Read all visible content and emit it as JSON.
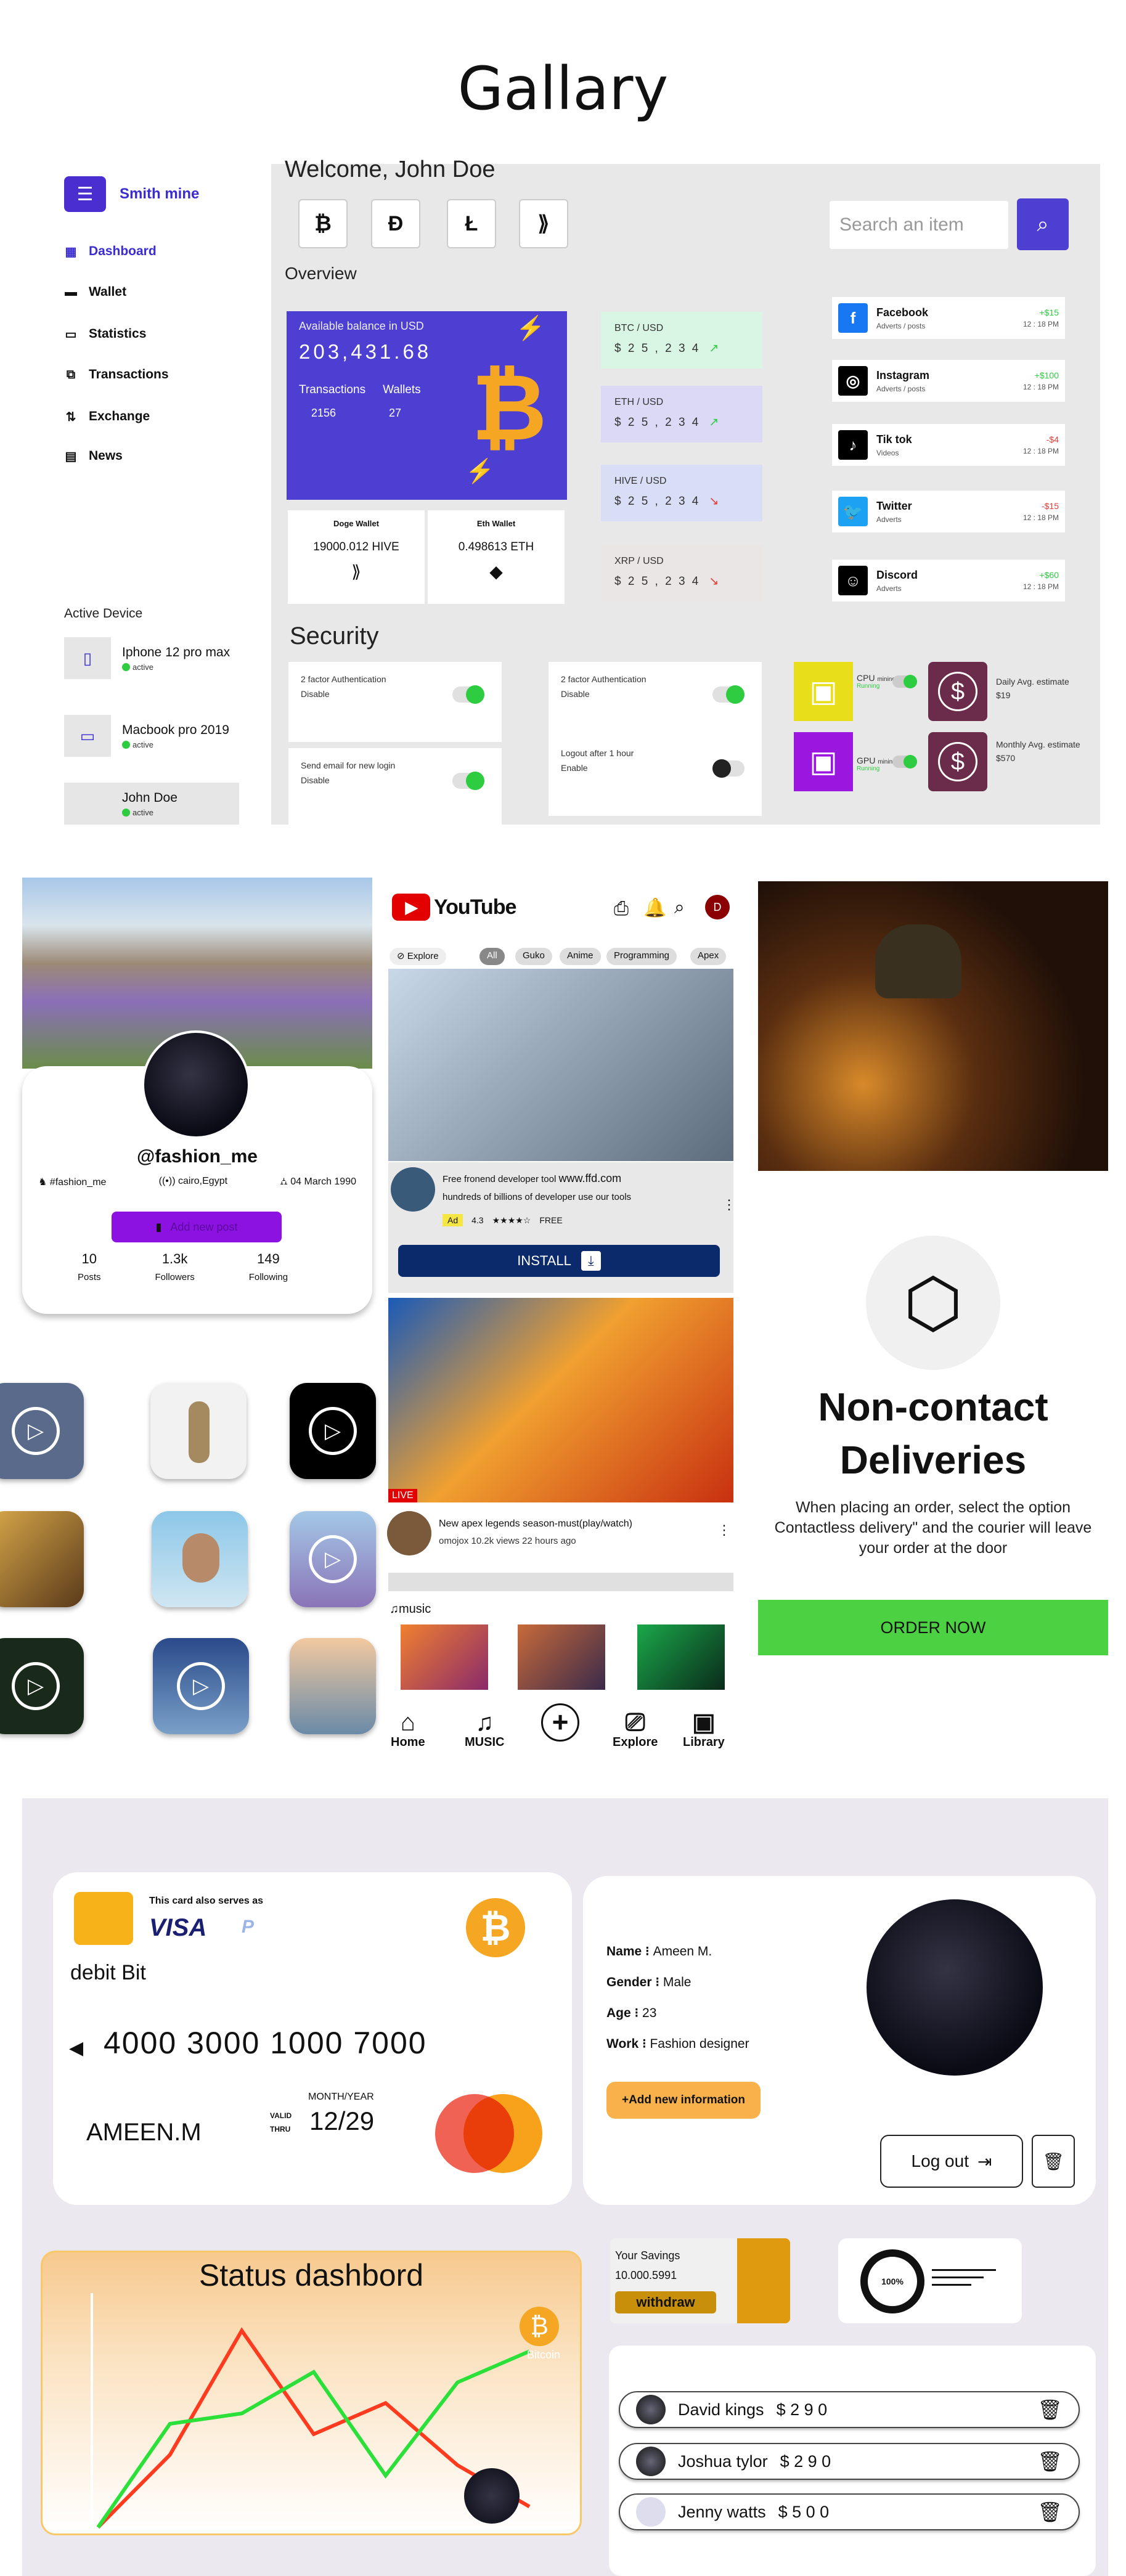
{
  "title": "Gallary",
  "dashboard": {
    "brand": "Smith mine",
    "nav": [
      {
        "label": "Dashboard",
        "icon": "grid-icon"
      },
      {
        "label": "Wallet",
        "icon": "wallet-icon"
      },
      {
        "label": "Statistics",
        "icon": "monitor-icon"
      },
      {
        "label": "Transactions",
        "icon": "transactions-icon"
      },
      {
        "label": "Exchange",
        "icon": "exchange-icon"
      },
      {
        "label": "News",
        "icon": "news-icon"
      }
    ],
    "active_device_label": "Active Device",
    "devices": [
      {
        "name": "Iphone 12 pro max",
        "status": "active"
      },
      {
        "name": "Macbook pro 2019",
        "status": "active"
      },
      {
        "name": "John Doe",
        "status": "active"
      }
    ],
    "welcome": "Welcome, John Doe",
    "search_placeholder": "Search an item",
    "overview": "Overview",
    "balance": {
      "label": "Available balance in USD",
      "amount": "203,431.68",
      "transactions_label": "Transactions",
      "wallets_label": "Wallets",
      "transactions": "2156",
      "wallets": "27"
    },
    "wallets": [
      {
        "title": "Doge Wallet",
        "value": "19000.012 HIVE"
      },
      {
        "title": "Eth Wallet",
        "value": "0.498613 ETH"
      }
    ],
    "pairs": [
      {
        "name": "BTC / USD",
        "value": "$ 2 5 , 2 3 4",
        "color": "#d9f5e3"
      },
      {
        "name": "ETH / USD",
        "value": "$ 2 5 , 2 3 4",
        "color": "#dcd9f7"
      },
      {
        "name": "HIVE / USD",
        "value": "$ 2 5 , 2 3 4",
        "color": "#d9def7"
      },
      {
        "name": "XRP / USD",
        "value": "$ 2 5 , 2 3 4",
        "color": "#ebe6e6"
      }
    ],
    "socials": [
      {
        "name": "Facebook",
        "sub": "Adverts / posts",
        "amount": "+$15",
        "time": "12 : 18 PM",
        "color": "#1877f2",
        "positive": true
      },
      {
        "name": "Instagram",
        "sub": "Adverts / posts",
        "amount": "+$100",
        "time": "12 : 18 PM",
        "color": "#000000",
        "positive": true
      },
      {
        "name": "Tik tok",
        "sub": "Videos",
        "amount": "-$4",
        "time": "12 : 18 PM",
        "color": "#000000",
        "positive": false
      },
      {
        "name": "Twitter",
        "sub": "Adverts",
        "amount": "-$15",
        "time": "12 : 18 PM",
        "color": "#1da1f2",
        "positive": false
      },
      {
        "name": "Discord",
        "sub": "Adverts",
        "amount": "+$60",
        "time": "12 : 18 PM",
        "color": "#000000",
        "positive": true
      }
    ],
    "security_title": "Security",
    "security": [
      {
        "title": "2 factor Authentication",
        "sub": "Disable",
        "on": true
      },
      {
        "title": "2 factor Authentication",
        "sub": "Disable",
        "on": true
      },
      {
        "title": "Send email for new login",
        "sub": "Disable",
        "on": true
      },
      {
        "title": "Logout after 1 hour",
        "sub": "Enable",
        "on": false
      }
    ],
    "mining": [
      {
        "label": "CPU",
        "state": "mining",
        "sub": "Running"
      },
      {
        "label": "GPU",
        "state": "mining",
        "sub": "Running"
      }
    ],
    "estimates": [
      {
        "label": "Daily Avg. estimate",
        "value": "$19"
      },
      {
        "label": "Monthly Avg. estimate",
        "value": "$570"
      }
    ]
  },
  "profile": {
    "handle": "@fashion_me",
    "tag": "#fashion_me",
    "location": "cairo,Egypt",
    "birthday": "04 March 1990",
    "add_post": "Add new post",
    "stats": [
      {
        "value": "10",
        "label": "Posts"
      },
      {
        "value": "1.3k",
        "label": "Followers"
      },
      {
        "value": "149",
        "label": "Following"
      }
    ]
  },
  "youtube": {
    "logo": "YouTube",
    "avatar_letter": "D",
    "chips": [
      "Explore",
      "All",
      "Guko",
      "Anime",
      "Programming",
      "Apex"
    ],
    "ad": {
      "title": "Free fronend developer tool",
      "url": "www.ffd.com",
      "desc": "hundreds of billions of developer use our tools",
      "badge": "Ad",
      "rating": "4.3",
      "price": "FREE",
      "install": "INSTALL"
    },
    "live_badge": "LIVE",
    "video": {
      "title": "New apex legends season-must(play/watch)",
      "meta": "omojox 10.2k views 22 hours ago"
    },
    "music_label": "music",
    "nav": [
      {
        "label": "Home",
        "icon": "home-icon"
      },
      {
        "label": "MUSIC",
        "icon": "music-icon"
      },
      {
        "label": "",
        "icon": "plus-icon"
      },
      {
        "label": "Explore",
        "icon": "explore-icon"
      },
      {
        "label": "Library",
        "icon": "library-icon"
      }
    ]
  },
  "delivery": {
    "title_line1": "Non-contact",
    "title_line2": "Deliveries",
    "text": "When placing an order, select the option Contactless delivery\" and the courier will leave your order at the door",
    "button": "ORDER NOW"
  },
  "card": {
    "serves_as": "This card also serves as",
    "visa": "VISA",
    "name": "debit Bit",
    "number": "4000 3000 1000 7000",
    "holder": "AMEEN.M",
    "valid_label": "VALID",
    "thru_label": "THRU",
    "expiry_label": "MONTH/YEAR",
    "expiry": "12/29"
  },
  "user_info": {
    "fields": [
      {
        "label": "Name",
        "value": "Ameen M."
      },
      {
        "label": "Gender",
        "value": "Male"
      },
      {
        "label": "Age",
        "value": "23"
      },
      {
        "label": "Work",
        "value": "Fashion designer"
      }
    ],
    "add_info": "Add new information",
    "logout": "Log out"
  },
  "status": {
    "title": "Status dashbord",
    "series": [
      {
        "color": "#ff3b1f",
        "points": [
          0,
          35,
          95,
          45,
          60,
          30,
          10
        ]
      },
      {
        "color": "#2ce03a",
        "points": [
          0,
          50,
          55,
          75,
          25,
          70,
          85
        ]
      }
    ],
    "legend_coin": "Bitcoin"
  },
  "savings": {
    "label": "Your Savings",
    "value": "10.000.5991",
    "button": "withdraw"
  },
  "progress": {
    "value": "100%",
    "fraction": 1.0
  },
  "people": [
    {
      "name": "David  kings",
      "amount": "$ 2 9 0"
    },
    {
      "name": "Joshua tylor",
      "amount": "$ 2 9 0"
    },
    {
      "name": "Jenny watts",
      "amount": "$ 5 0 0"
    }
  ]
}
